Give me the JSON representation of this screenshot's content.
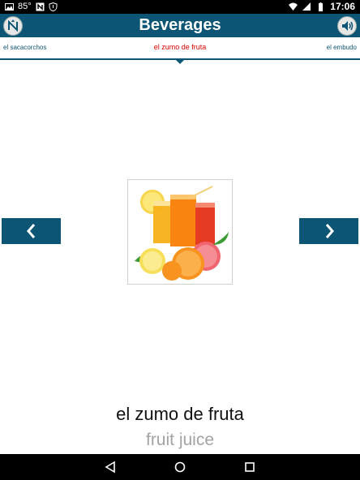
{
  "status_bar": {
    "temperature": "85°",
    "time": "17:06",
    "icons": [
      "photo-icon",
      "app-notification-icon",
      "shield-alert-icon",
      "wifi-icon",
      "signal-icon",
      "battery-icon"
    ]
  },
  "app_bar": {
    "title": "Beverages",
    "logo_icon": "app-logo-icon",
    "speaker_icon": "speaker-icon"
  },
  "word_nav": {
    "prev_label": "el sacacorchos",
    "current_label": "el zumo de fruta",
    "next_label": "el embudo"
  },
  "card": {
    "image_label": "fruit-juice-image",
    "word": "el zumo de fruta",
    "translation": "fruit juice"
  },
  "colors": {
    "brand": "#0d5574",
    "current_word": "#d80000",
    "translation": "#a3a3a3"
  },
  "system_nav": [
    "back-icon",
    "home-icon",
    "recents-icon"
  ]
}
